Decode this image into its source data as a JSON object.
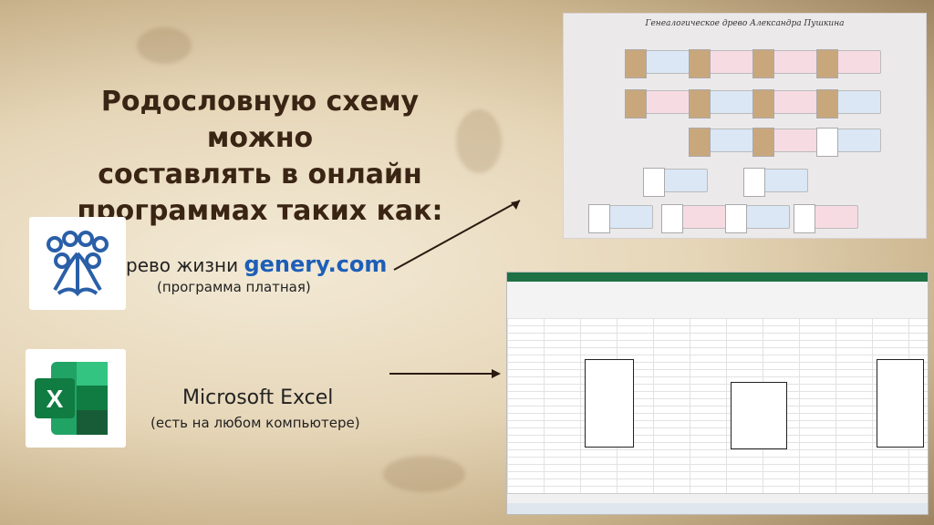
{
  "heading": {
    "line1": "Родословную схему можно",
    "line2": "составлять в онлайн",
    "line3": "программах таких как:"
  },
  "genery": {
    "prefix": "рево жизни",
    "brand": "genery.com",
    "note": "(программа платная)"
  },
  "excel": {
    "name": "Microsoft Excel",
    "note": "(есть на любом компьютере)"
  },
  "tree_screenshot": {
    "title": "Генеалогическое древо Александра Пушкина"
  },
  "colors": {
    "heading": "#3a2413",
    "brand": "#1d5fb8",
    "excel_green": "#1e7145"
  }
}
